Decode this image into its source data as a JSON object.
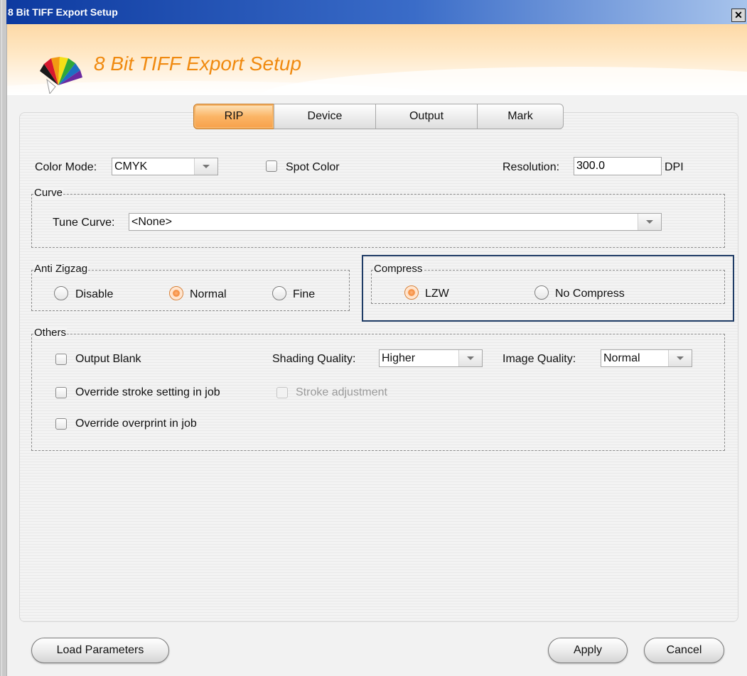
{
  "window": {
    "title": "8 Bit TIFF Export Setup",
    "close_glyph": "✕"
  },
  "banner": {
    "heading": "8 Bit TIFF Export Setup",
    "logo_icon": "color-fan-icon"
  },
  "tabs": [
    {
      "label": "RIP",
      "active": true
    },
    {
      "label": "Device",
      "active": false
    },
    {
      "label": "Output",
      "active": false
    },
    {
      "label": "Mark",
      "active": false
    }
  ],
  "rip": {
    "color_mode": {
      "label": "Color Mode:",
      "value": "CMYK"
    },
    "spot_color": {
      "label": "Spot Color",
      "checked": false
    },
    "resolution": {
      "label": "Resolution:",
      "value": "300.0",
      "unit": "DPI"
    },
    "curve": {
      "title": "Curve",
      "tune_curve": {
        "label": "Tune Curve:",
        "value": "<None>"
      }
    },
    "anti_zigzag": {
      "title": "Anti Zigzag",
      "options": [
        {
          "label": "Disable",
          "selected": false
        },
        {
          "label": "Normal",
          "selected": true
        },
        {
          "label": "Fine",
          "selected": false
        }
      ]
    },
    "compress": {
      "title": "Compress",
      "options": [
        {
          "label": "LZW",
          "selected": true
        },
        {
          "label": "No Compress",
          "selected": false
        }
      ]
    },
    "others": {
      "title": "Others",
      "output_blank": {
        "label": "Output Blank",
        "checked": false
      },
      "shading_quality": {
        "label": "Shading Quality:",
        "value": "Higher"
      },
      "image_quality": {
        "label": "Image Quality:",
        "value": "Normal"
      },
      "override_stroke": {
        "label": "Override stroke setting in job",
        "checked": false
      },
      "stroke_adjustment": {
        "label": "Stroke adjustment",
        "checked": false,
        "enabled": false
      },
      "override_overprint": {
        "label": "Override overprint in job",
        "checked": false
      }
    }
  },
  "footer": {
    "load_label": "Load Parameters",
    "apply_label": "Apply",
    "cancel_label": "Cancel"
  },
  "colors": {
    "titlebar_start": "#0d3aa0",
    "accent_orange": "#f08a10",
    "highlight_border": "#1f3c66"
  }
}
